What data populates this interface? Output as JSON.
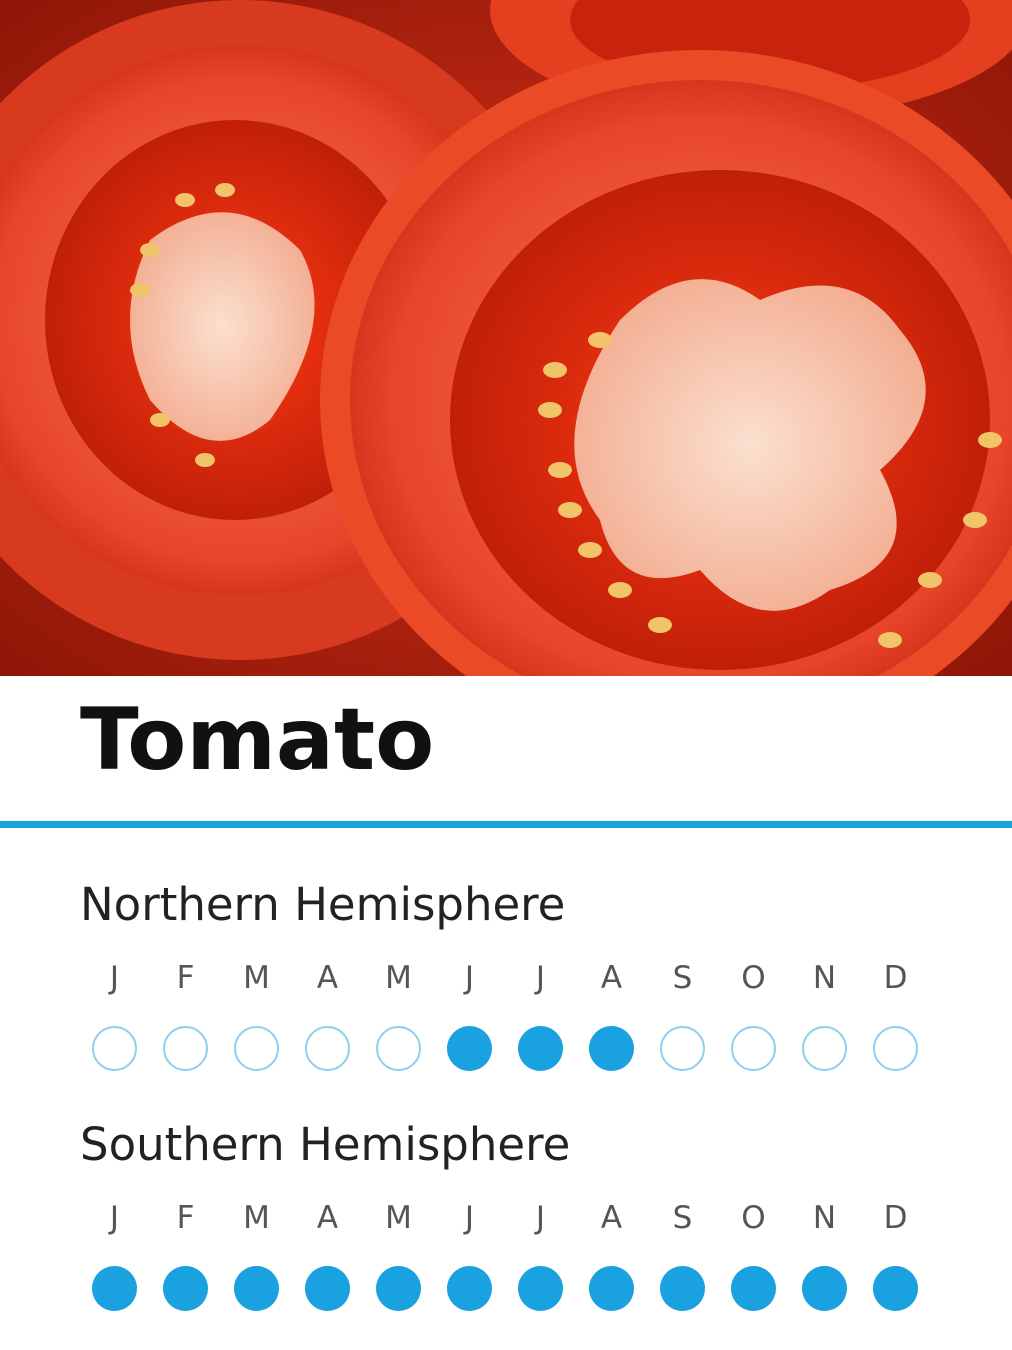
{
  "header": {
    "title": "Tomato",
    "image": "tomato-slices-photo"
  },
  "colors": {
    "accent": "#1aa1e0",
    "off_outline": "#8fd0ee",
    "title": "#111111",
    "label": "#555555"
  },
  "northern": {
    "title": "Northern Hemisphere",
    "months": [
      {
        "label": "J",
        "in_season": false
      },
      {
        "label": "F",
        "in_season": false
      },
      {
        "label": "M",
        "in_season": false
      },
      {
        "label": "A",
        "in_season": false
      },
      {
        "label": "M",
        "in_season": false
      },
      {
        "label": "J",
        "in_season": true
      },
      {
        "label": "J",
        "in_season": true
      },
      {
        "label": "A",
        "in_season": true
      },
      {
        "label": "S",
        "in_season": false
      },
      {
        "label": "O",
        "in_season": false
      },
      {
        "label": "N",
        "in_season": false
      },
      {
        "label": "D",
        "in_season": false
      }
    ]
  },
  "southern": {
    "title": "Southern Hemisphere",
    "months": [
      {
        "label": "J",
        "in_season": true
      },
      {
        "label": "F",
        "in_season": true
      },
      {
        "label": "M",
        "in_season": true
      },
      {
        "label": "A",
        "in_season": true
      },
      {
        "label": "M",
        "in_season": true
      },
      {
        "label": "J",
        "in_season": true
      },
      {
        "label": "J",
        "in_season": true
      },
      {
        "label": "A",
        "in_season": true
      },
      {
        "label": "S",
        "in_season": true
      },
      {
        "label": "O",
        "in_season": true
      },
      {
        "label": "N",
        "in_season": true
      },
      {
        "label": "D",
        "in_season": true
      }
    ]
  }
}
